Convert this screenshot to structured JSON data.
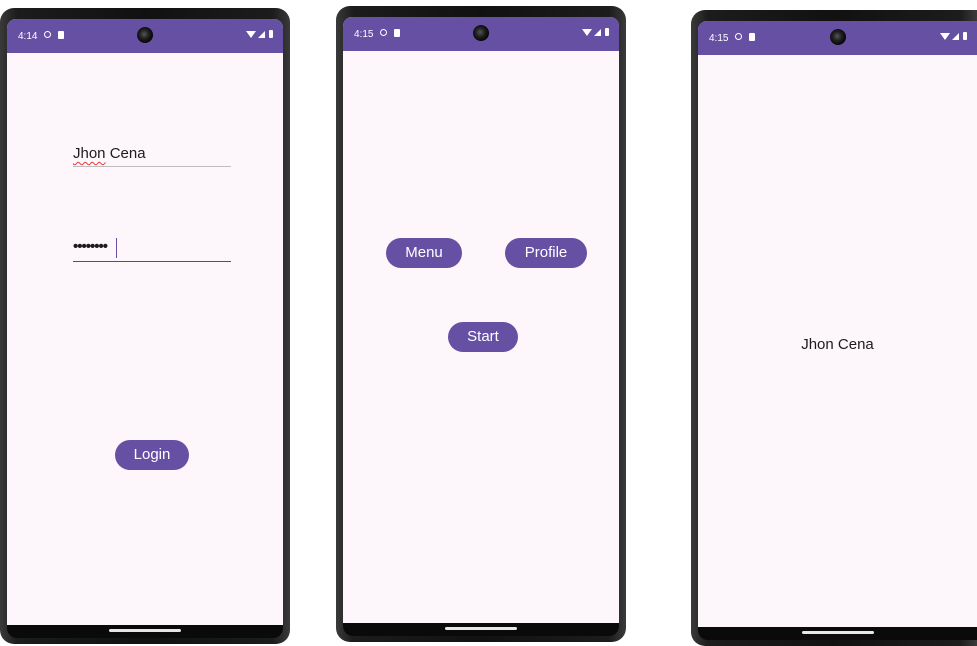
{
  "screens": {
    "login": {
      "status_time": "4:14",
      "username_first": "Jhon",
      "username_rest": " Cena",
      "password_mask": "••••••••",
      "login_label": "Login"
    },
    "home": {
      "status_time": "4:15",
      "menu_label": "Menu",
      "profile_label": "Profile",
      "start_label": "Start"
    },
    "profile": {
      "status_time": "4:15",
      "name": "Jhon Cena"
    }
  },
  "colors": {
    "accent": "#6650a4",
    "screen_background": "#fdf7fc",
    "spellcheck": "#e53935"
  },
  "icons": [
    "data-saver-icon",
    "sim-card-icon",
    "wifi-icon",
    "signal-icon",
    "battery-icon"
  ]
}
